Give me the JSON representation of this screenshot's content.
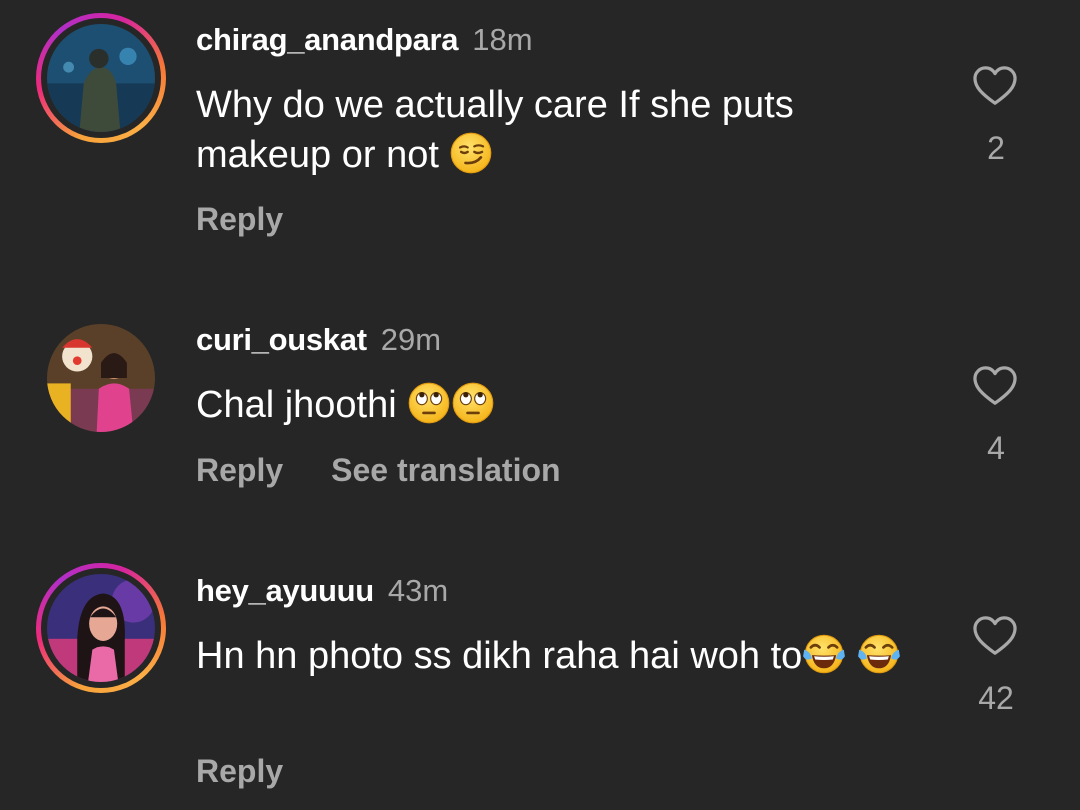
{
  "comments": [
    {
      "username": "chirag_anandpara",
      "time": "18m",
      "text": "Why do we actually care If she puts makeup or not",
      "emojis": [
        "smirk-emoji"
      ],
      "reply_label": "Reply",
      "likes": "2"
    },
    {
      "username": "curi_ouskat",
      "time": "29m",
      "text": "Chal jhoothi ",
      "emojis": [
        "eye-roll-emoji",
        "eye-roll-emoji"
      ],
      "reply_label": "Reply",
      "see_translation_label": "See translation",
      "likes": "4"
    },
    {
      "username": "hey_ayuuuu",
      "time": "43m",
      "text": "Hn hn photo ss dikh raha hai woh to",
      "emojis": [
        "tears-of-joy-emoji",
        "tears-of-joy-emoji"
      ],
      "reply_label": "Reply",
      "likes": "42"
    }
  ],
  "colors": {
    "background": "#262626",
    "secondary_text": "#a8a8a8",
    "primary_text": "#ffffff",
    "story_ring": "#ee2a7b"
  },
  "icons": {
    "like": "heart-outline-icon"
  }
}
